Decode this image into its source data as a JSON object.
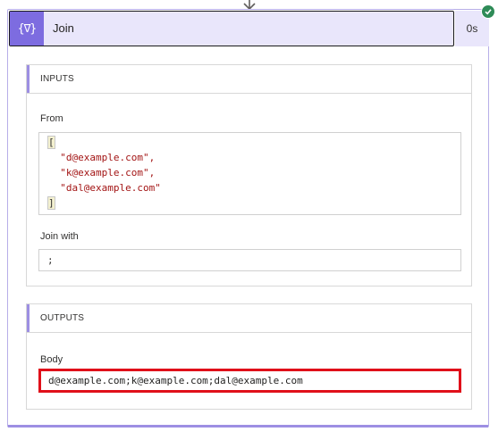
{
  "action": {
    "title": "Join",
    "icon": "expression-icon",
    "icon_glyph": "{∇}",
    "duration": "0s",
    "status": "succeeded",
    "accent_color": "#7d6ce0",
    "status_color": "#2e8b57"
  },
  "inputs": {
    "section_title": "INPUTS",
    "from_label": "From",
    "from_open_bracket": "[",
    "from_items": [
      "\"d@example.com\",",
      "\"k@example.com\",",
      "\"dal@example.com\""
    ],
    "from_close_bracket": "]",
    "join_with_label": "Join with",
    "join_with_value": ";"
  },
  "outputs": {
    "section_title": "OUTPUTS",
    "body_label": "Body",
    "body_value": "d@example.com;k@example.com;dal@example.com",
    "highlight_color": "#e0101a"
  }
}
